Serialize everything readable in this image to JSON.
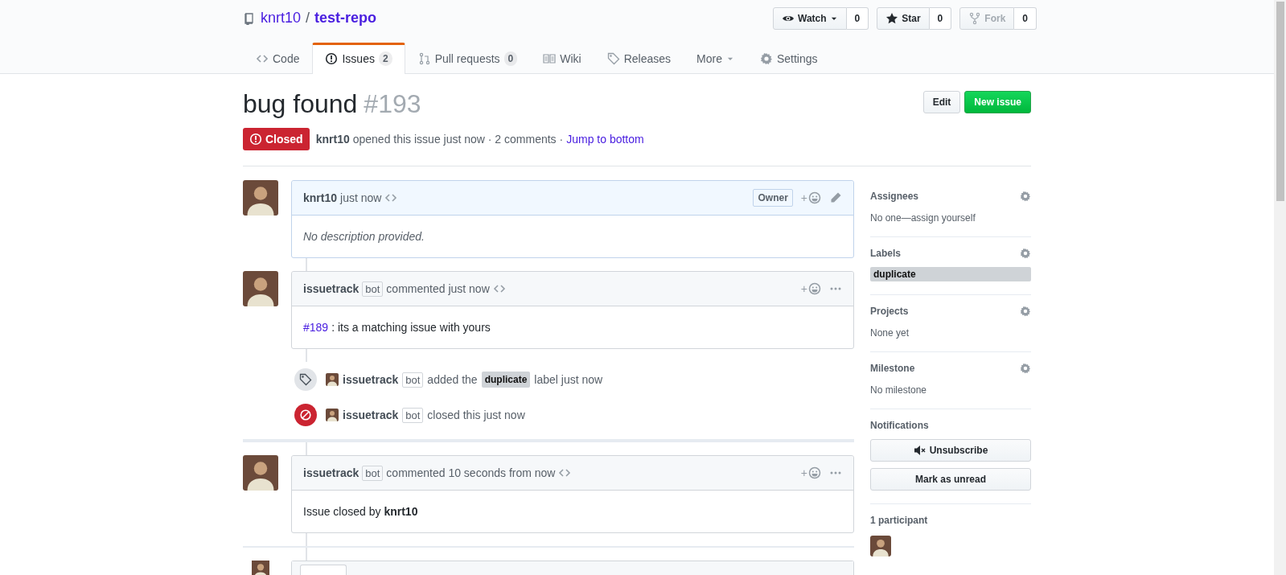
{
  "repo": {
    "owner": "knrt10",
    "separator": "/",
    "name": "test-repo"
  },
  "social": [
    {
      "kind": "watch",
      "label": "Watch",
      "count": "0",
      "disabled": false
    },
    {
      "kind": "star",
      "label": "Star",
      "count": "0",
      "disabled": false
    },
    {
      "kind": "fork",
      "label": "Fork",
      "count": "0",
      "disabled": true
    }
  ],
  "tabs": [
    {
      "kind": "code",
      "label": "Code",
      "selected": false
    },
    {
      "kind": "issues",
      "label": "Issues",
      "count": "2",
      "selected": true
    },
    {
      "kind": "pulls",
      "label": "Pull requests",
      "count": "0",
      "selected": false
    },
    {
      "kind": "wiki",
      "label": "Wiki",
      "selected": false
    },
    {
      "kind": "releases",
      "label": "Releases",
      "selected": false
    },
    {
      "kind": "more",
      "label": "More",
      "selected": false
    },
    {
      "kind": "settings",
      "label": "Settings",
      "selected": false
    }
  ],
  "issue": {
    "title": "bug found",
    "number": "#193",
    "state": "Closed",
    "author": "knrt10",
    "meta": "opened this issue just now · 2 comments ·",
    "jump": "Jump to bottom",
    "buttons": [
      {
        "kind": "default",
        "label": "Edit"
      },
      {
        "kind": "primary",
        "label": "New issue"
      }
    ]
  },
  "timeline": [
    {
      "kind": "comment",
      "author": "knrt10",
      "action": "just now",
      "owner_badge": "Owner",
      "reaction": "+",
      "menu": {
        "kind": "edit"
      },
      "highlighted": true,
      "body": "No description provided.",
      "body_italic": true
    },
    {
      "kind": "comment",
      "author": "issuetrack",
      "bot": "bot",
      "action": "commented just now",
      "reaction": "+",
      "menu": {
        "kind": "more"
      },
      "highlighted": false,
      "link": "#189",
      "body": ": its a matching issue with yours",
      "body_italic": false
    },
    {
      "kind": "label_event",
      "author": "issuetrack",
      "bot": "bot",
      "text": "added the",
      "label": "duplicate",
      "after": "label just now"
    },
    {
      "kind": "close_event",
      "author": "issuetrack",
      "bot": "bot",
      "text": "closed this just now"
    },
    {
      "kind": "divider"
    },
    {
      "kind": "comment",
      "author": "issuetrack",
      "bot": "bot",
      "action": "commented 10 seconds from now",
      "reaction": "+",
      "menu": {
        "kind": "more"
      },
      "highlighted": false,
      "body": "Issue closed by **knrt10**",
      "body_italic": false
    },
    {
      "kind": "divider"
    },
    {
      "kind": "form"
    }
  ],
  "sidebar": [
    {
      "title": "Assignees",
      "gear": true,
      "text": "No one—assign yourself"
    },
    {
      "title": "Labels",
      "gear": true,
      "labels": [
        {
          "name": "duplicate",
          "color": "#cfd3d7"
        }
      ]
    },
    {
      "title": "Projects",
      "gear": true,
      "text": "None yet"
    },
    {
      "title": "Milestone",
      "gear": true,
      "text": "No milestone"
    },
    {
      "title": "Notifications",
      "gear": false,
      "buttons": [
        {
          "kind": "unsubscribe",
          "label": "Unsubscribe"
        },
        {
          "kind": "plain",
          "label": "Mark as unread"
        }
      ]
    },
    {
      "title": "1 participant",
      "gear": false,
      "participants": [
        {
          "kind": "avatar"
        }
      ]
    }
  ]
}
